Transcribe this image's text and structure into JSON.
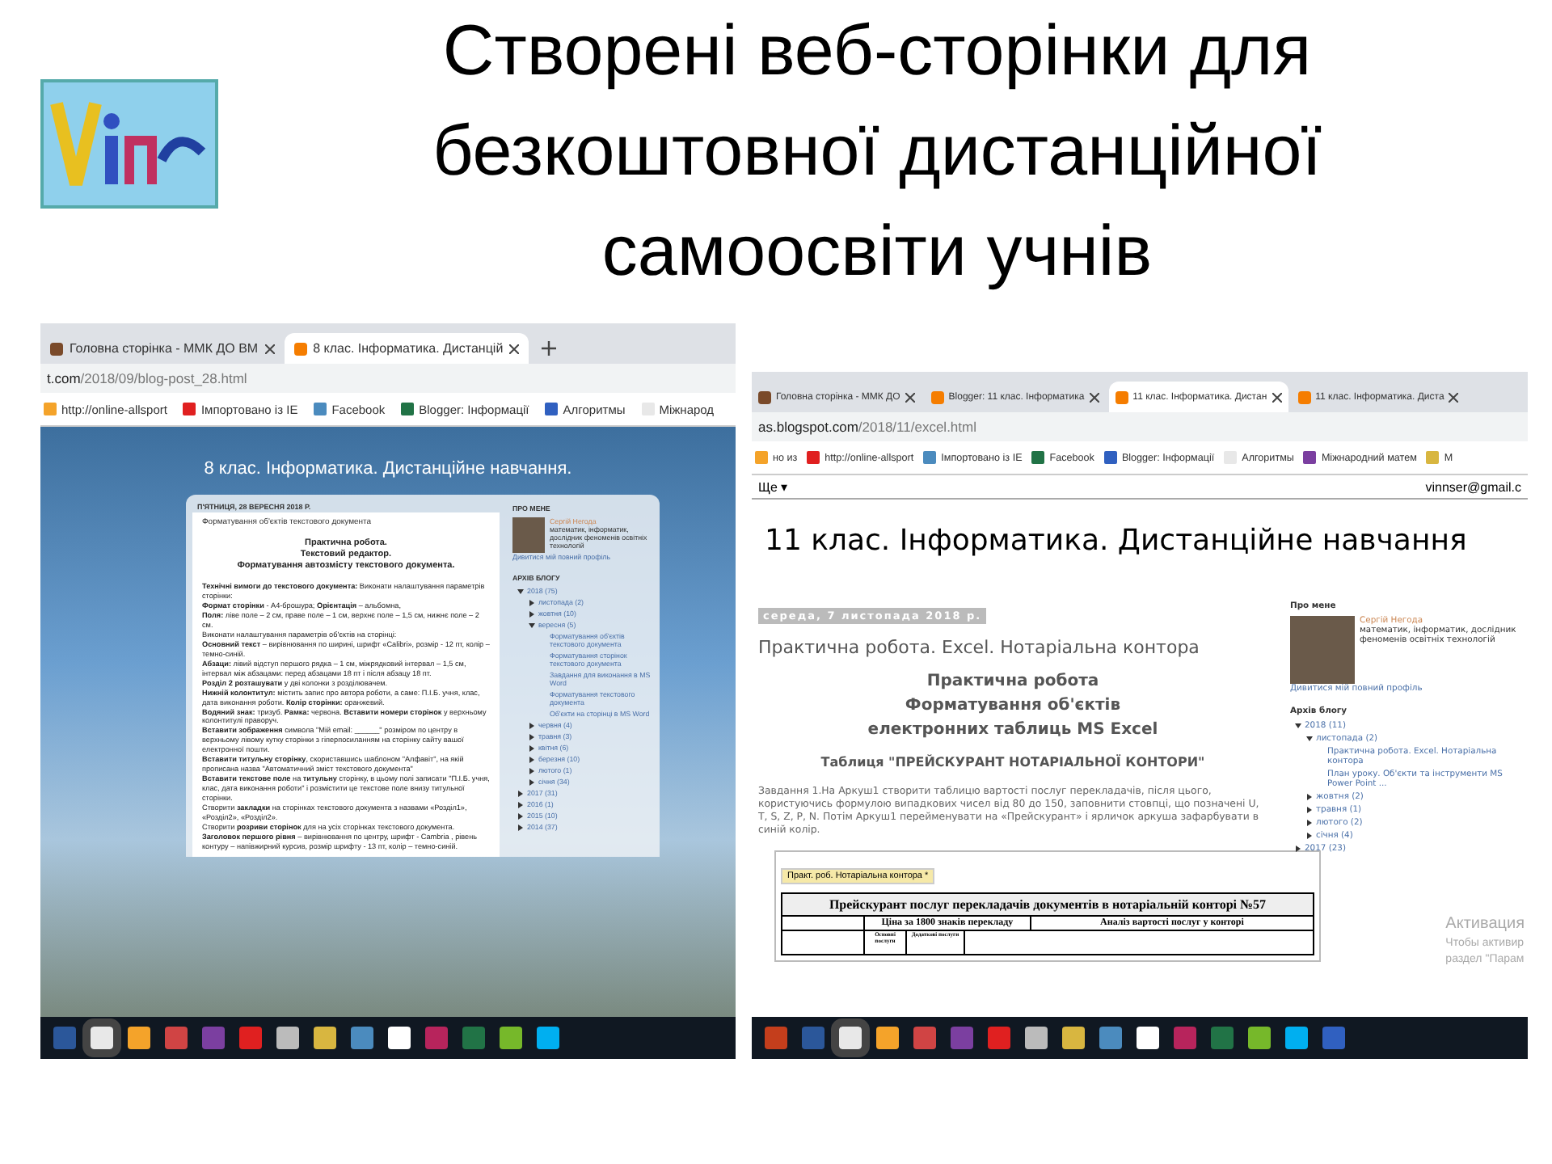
{
  "slide_title": "Створені веб-сторінки для безкоштовної дистанційної самоосвіти учнів",
  "browsers": [
    {
      "kind": "sky",
      "tabs": [
        {
          "label": "Головна сторінка - ММК ДО ВМ",
          "selected": false
        },
        {
          "label": "8 клас. Інформатика. Дистанцій",
          "selected": true
        }
      ],
      "address": {
        "host": "t.com",
        "path": "/2018/09/blog-post_28.html"
      },
      "bookmarks": [
        "http://online-allsport",
        "Імпортовано із IE",
        "Facebook",
        "Blogger: Інформації",
        "Алгоритмы",
        "Міжнарод"
      ],
      "blog_title": "8 клас. Інформатика. Дистанційне навчання.",
      "post": {
        "date": "П'ЯТНИЦЯ, 28 ВЕРЕСНЯ 2018 Р.",
        "title": "Форматування об'єктів текстового документа",
        "heading": [
          "Практична робота.",
          "Текстовий редактор.",
          "Форматування автозмісту  текстового документа."
        ],
        "paragraphs": [
          "**Технічні вимоги до текстового документа:**   Виконати налаштування параметрів сторінки:",
          "**Формат сторінки** - А4-брошура; **Орієнтація** – альбомна,",
          "**Поля:**  ліве поле – 2  см, праве поле – 1 см, верхнє поле – 1,5 см, нижнє поле – 2 см.",
          "Виконати налаштування параметрів об'єктів на сторінці:",
          "**Основний текст** – вирівнювання по ширині, шрифт «Calibri», розмір - 12 пт,  колір – темно-синій.",
          "**Абзаци:**  лівий відступ першого рядка – 1 см, міжрядковий інтервал – 1,5 см, інтервал між абзацами: перед абзацами 18 пт  і після абзацу 18 пт.",
          "**Розділ 2 розташувати** у дві колонки  з розділювачем.",
          "**Нижній колонтитул:** містить запис про автора роботи, а саме: П.І.Б. учня, клас, дата виконання роботи. **Колір сторінки:** оранжевий.",
          "**Водяний  знак:** тризуб.   **Рамка:** червона. **Вставити номери сторінок** у верхньому колонтитулі  праворуч.",
          "**Вставити зображення** символа \"Мій email: ______\" розміром  по центру в верхньому лівому кутку сторінки з гіперпосиланням на сторінку сайту вашої електронної пошти.",
          "**Вставити титульну сторінку**, скориставшись шаблоном \"Алфавіт\", на якій прописана назва \"Автоматичний зміст текстового документа\"",
          "**Вставити текстове поле** на **титульну** сторінку, в цьому полі записати \"П.І.Б. учня, клас, дата виконання роботи\" і розмістити це текстове поле внизу титульної сторінки.",
          "Створити  **закладки** на сторінках текстового документа з назвами «Розділ1»,  «Розділ2», «Розділ2».",
          "Створити  **розриви сторінок** для на усіх сторінках текстового документа.",
          "**Заголовок  першого рівня** – вирівнювання по центру, шрифт - Cambria , рівень контуру – напівжирний курсив, розмір шрифту - 13 пт,  колір – темно-синій."
        ]
      },
      "sidebar": {
        "about_heading": "ПРО МЕНЕ",
        "author": "Сергій Негода",
        "bio": "математик, інформатик, дослідник феноменів освітніх технологій",
        "profile_link": "Дивитися мій повний профіль",
        "archive_heading": "АРХІВ БЛОГУ",
        "archive": [
          {
            "label": "2018 (75)",
            "expanded": true,
            "children": [
              {
                "label": "листопада (2)",
                "expanded": false
              },
              {
                "label": "жовтня (10)",
                "expanded": false
              },
              {
                "label": "вересня (5)",
                "expanded": true,
                "children": [
                  {
                    "label": "Форматування об'єктів текстового документа"
                  },
                  {
                    "label": "Форматування сторінок текстового документа"
                  },
                  {
                    "label": "Завдання для виконання в MS Word"
                  },
                  {
                    "label": "Форматування текстового документа"
                  },
                  {
                    "label": "Об'єкти на сторінці в MS Word"
                  }
                ]
              },
              {
                "label": "червня (4)",
                "expanded": false
              },
              {
                "label": "травня (3)",
                "expanded": false
              },
              {
                "label": "квітня (6)",
                "expanded": false
              },
              {
                "label": "березня (10)",
                "expanded": false
              },
              {
                "label": "лютого (1)",
                "expanded": false
              },
              {
                "label": "січня (34)",
                "expanded": false
              }
            ]
          },
          {
            "label": "2017 (31)",
            "expanded": false
          },
          {
            "label": "2016 (1)",
            "expanded": false
          },
          {
            "label": "2015 (10)",
            "expanded": false
          },
          {
            "label": "2014 (37)",
            "expanded": false
          }
        ]
      },
      "taskbar": [
        {
          "selected": false
        },
        {
          "selected": true
        },
        {
          "selected": false
        },
        {
          "selected": false
        },
        {
          "selected": false
        },
        {
          "selected": false
        },
        {
          "selected": false
        },
        {
          "selected": false
        },
        {
          "selected": false
        },
        {
          "selected": false
        },
        {
          "selected": false
        },
        {
          "selected": false
        },
        {
          "selected": false
        },
        {
          "selected": false
        }
      ]
    },
    {
      "kind": "plain",
      "tabs": [
        {
          "label": "Головна сторінка - ММК ДО",
          "selected": false
        },
        {
          "label": "Blogger: 11 клас. Інформатика",
          "selected": false
        },
        {
          "label": "11 клас. Інформатика. Дистан",
          "selected": true
        },
        {
          "label": "11 клас. Інформатика. Диста",
          "selected": false
        }
      ],
      "address": {
        "host": "as.blogspot.com",
        "path": "/2018/11/excel.html"
      },
      "bookmarks": [
        "но из",
        "http://online-allsport",
        "Імпортовано із IE",
        "Facebook",
        "Blogger: Інформації",
        "Алгоритмы",
        "Міжнародний матем",
        "М"
      ],
      "account_bar": {
        "menu": "Ще ▾",
        "email": "vinnser@gmail.c"
      },
      "blog_title": "11 клас. Інформатика. Дистанційне навчання",
      "post": {
        "date": "середа, 7 листопада 2018 р.",
        "title": "Практична робота. Excel. Нотаріальна контора",
        "heading": [
          "Практична робота",
          "Форматування об'єктів",
          "електронних таблиць MS Excel"
        ],
        "subheading": "Таблиця  \"ПРЕЙСКУРАНТ НОТАРІАЛЬНОЇ КОНТОРИ\"",
        "paragraphs": [
          "Завдання  1.На Аркуш1 створити таблицю вартості послуг перекладачів, після цього, користуючись формулою випадкових чисел від  80 до 150, заповнити  стовпці, що позначені  U, T, S, Z, P, N.  Потім Аркуш1 перейменувати на «Прейскурант» і  ярличок аркуша зафарбувати в синій колір."
        ],
        "spreadsheet": {
          "tab": "Практ. роб. Нотаріальна контора *",
          "title": "Прейскурант послуг перекладачів документів в нотаріальній конторі №57",
          "group_headers": [
            "Ціна за 1800 знаків перекладу",
            "Аналіз вартості послуг у конторі"
          ],
          "column_headers": [
            "Основні послуги",
            "Додаткові послуги"
          ]
        }
      },
      "sidebar": {
        "about_heading": "Про мене",
        "author": "Сергій Негода",
        "bio": "математик, інформатик, дослідник феноменів освітніх технологій",
        "profile_link": "Дивитися мій повний профіль",
        "archive_heading": "Архів блогу",
        "archive": [
          {
            "label": "2018 (11)",
            "expanded": true,
            "children": [
              {
                "label": "листопада (2)",
                "expanded": true,
                "children": [
                  {
                    "label": "Практична робота. Excel. Нотаріальна контора"
                  },
                  {
                    "label": "План уроку. Об'єкти та інструменти MS Power Point ..."
                  }
                ]
              },
              {
                "label": "жовтня (2)",
                "expanded": false
              },
              {
                "label": "травня (1)",
                "expanded": false
              },
              {
                "label": "лютого (2)",
                "expanded": false
              },
              {
                "label": "січня (4)",
                "expanded": false
              }
            ]
          },
          {
            "label": "2017 (23)",
            "expanded": false
          }
        ]
      },
      "activation_notice": [
        "Активация",
        "Чтобы активир",
        "раздел \"Парам"
      ],
      "taskbar": [
        {
          "selected": false
        },
        {
          "selected": false
        },
        {
          "selected": true
        },
        {
          "selected": false
        },
        {
          "selected": false
        },
        {
          "selected": false
        },
        {
          "selected": false
        },
        {
          "selected": false
        },
        {
          "selected": false
        },
        {
          "selected": false
        },
        {
          "selected": false
        },
        {
          "selected": false
        },
        {
          "selected": false
        },
        {
          "selected": false
        },
        {
          "selected": false
        },
        {
          "selected": false
        }
      ]
    }
  ]
}
